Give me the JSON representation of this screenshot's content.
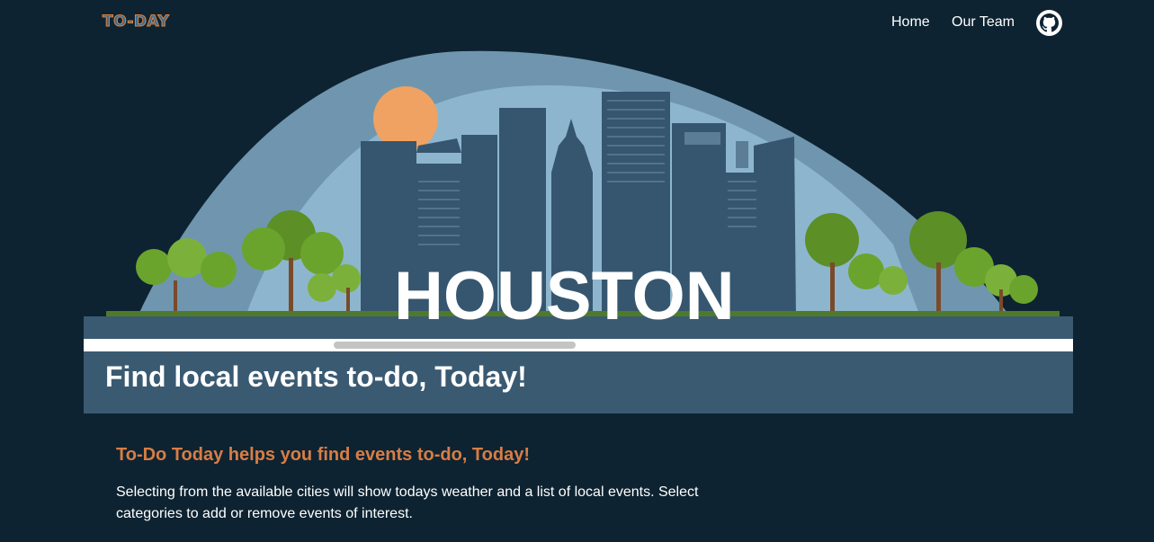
{
  "nav": {
    "logo_text": "TO-DAY",
    "links": [
      "Home",
      "Our Team"
    ],
    "github_icon": "github-icon"
  },
  "hero": {
    "city_label": "HOUSTON",
    "sky_color": "#7fa9c4",
    "building_color": "#36566f",
    "sun_color": "#f0a262",
    "tree_color": "#6aa42c"
  },
  "banner": {
    "title": "Find local events to-do, Today!"
  },
  "intro": {
    "heading": "To-Do Today helps you find events to-do, Today!",
    "body": "Selecting from the available cities will show todays weather and a list of local events. Select categories to add or remove events of interest."
  },
  "colors": {
    "page_background": "#0d2331",
    "banner_background": "#3a5a72",
    "accent": "#d97d45"
  }
}
